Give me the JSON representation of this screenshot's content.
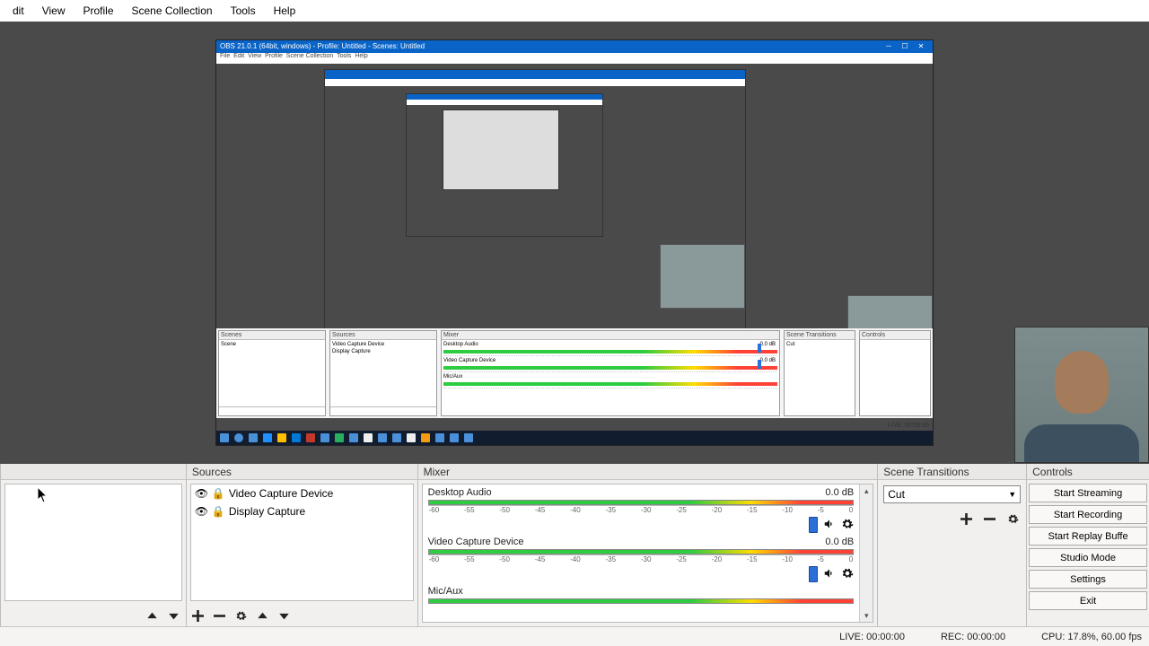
{
  "menu": [
    "dit",
    "View",
    "Profile",
    "Scene Collection",
    "Tools",
    "Help"
  ],
  "inner_window": {
    "title": "OBS 21.0.1 (64bit, windows) - Profile: Untitled - Scenes: Untitled",
    "menu": [
      "File",
      "Edit",
      "View",
      "Profile",
      "Scene Collection",
      "Tools",
      "Help"
    ],
    "panels": {
      "scenes": "Scenes",
      "scene_item": "Scene",
      "sources": "Sources",
      "src1": "Video Capture Device",
      "src2": "Display Capture",
      "mixer": "Mixer",
      "mix1": "Desktop Audio",
      "mix2": "Video Capture Device",
      "mix3": "Mic/Aux",
      "trans": "Scene Transitions",
      "trans_val": "Cut",
      "controls": "Controls"
    },
    "db": "0.0 dB",
    "status": "LIVE: 00:00:00"
  },
  "panels": {
    "sources": {
      "title": "Sources",
      "items": [
        "Video Capture Device",
        "Display Capture"
      ]
    },
    "mixer": {
      "title": "Mixer",
      "scale": [
        "-60",
        "-55",
        "-50",
        "-45",
        "-40",
        "-35",
        "-30",
        "-25",
        "-20",
        "-15",
        "-10",
        "-5",
        "0"
      ],
      "items": [
        {
          "name": "Desktop Audio",
          "db": "0.0 dB"
        },
        {
          "name": "Video Capture Device",
          "db": "0.0 dB"
        },
        {
          "name": "Mic/Aux",
          "db": ""
        }
      ]
    },
    "transitions": {
      "title": "Scene Transitions",
      "value": "Cut"
    },
    "controls": {
      "title": "Controls",
      "buttons": [
        "Start Streaming",
        "Start Recording",
        "Start Replay Buffe",
        "Studio Mode",
        "Settings",
        "Exit"
      ]
    }
  },
  "status": {
    "live": "LIVE: 00:00:00",
    "rec": "REC: 00:00:00",
    "cpu": "CPU: 17.8%, 60.00 fps"
  }
}
